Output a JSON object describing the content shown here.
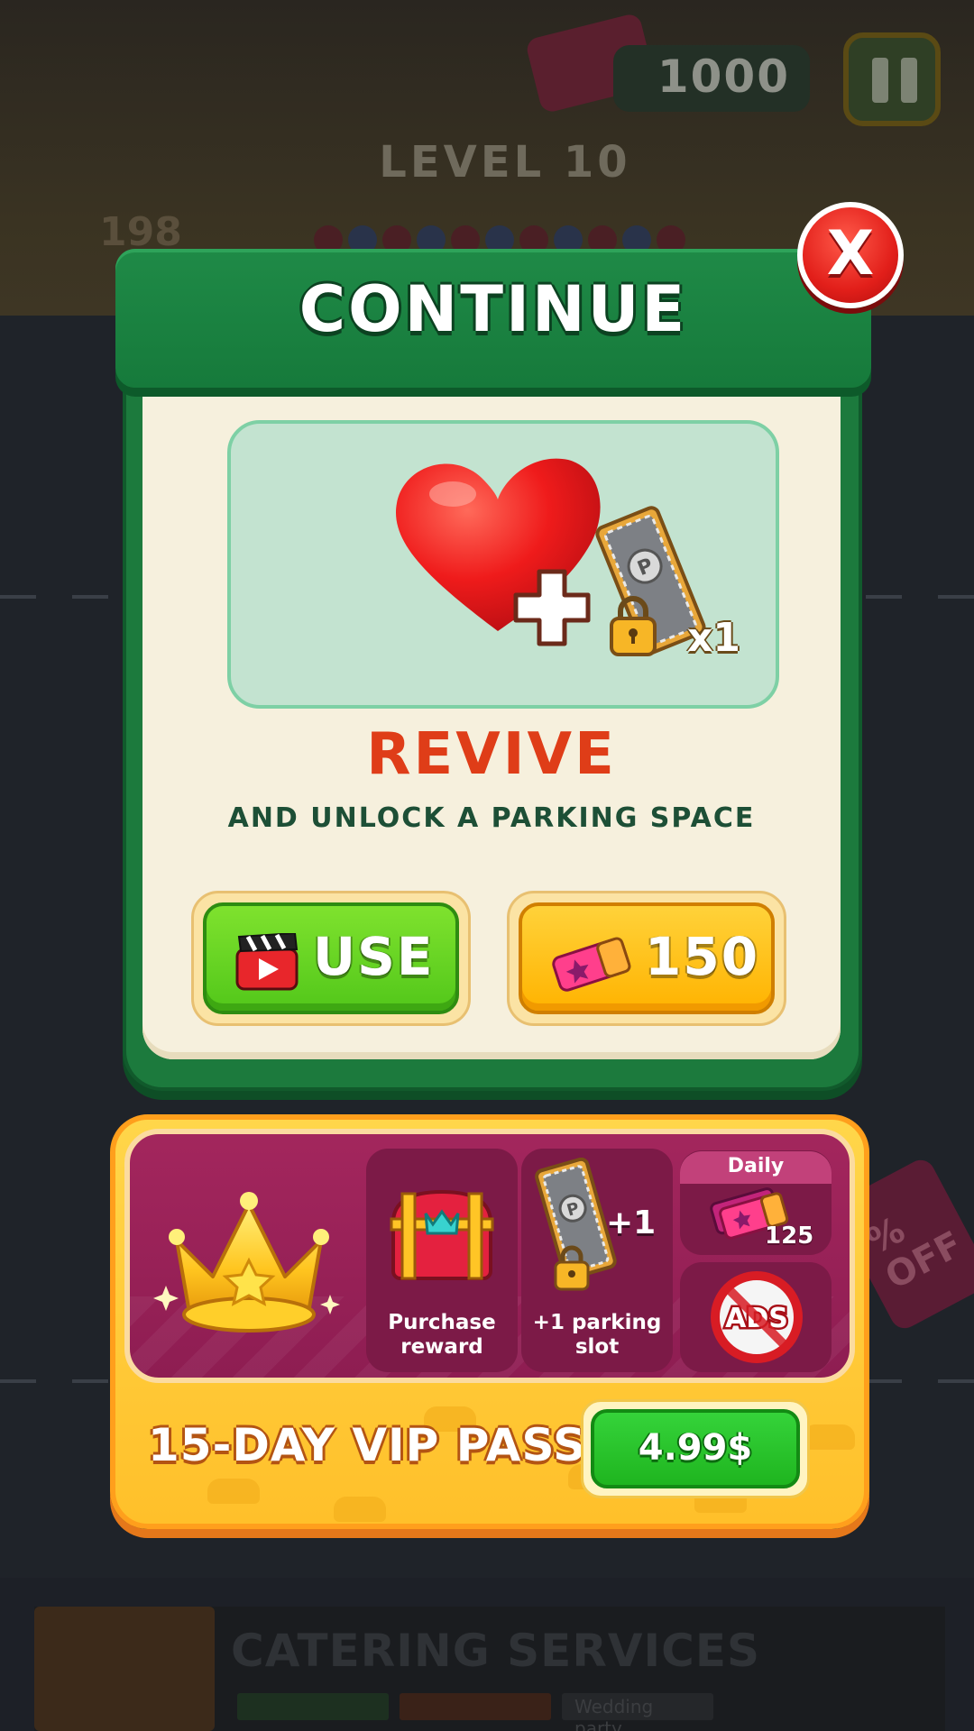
{
  "hud": {
    "coins": "1000",
    "level": "LEVEL 10",
    "remaining": "198",
    "icons": [
      "ticket-icon",
      "pause-icon"
    ]
  },
  "side_offer": {
    "text": "% OFF"
  },
  "modal": {
    "title": "CONTINUE",
    "close_label": "X",
    "reward_quantity": "x1",
    "revive_title": "REVIVE",
    "revive_subtitle": "AND UNLOCK A PARKING SPACE",
    "use_label": "USE",
    "buy_price": "150",
    "icons": [
      "heart-icon",
      "plus-icon",
      "parking-ticket-icon",
      "lock-icon",
      "video-ad-icon",
      "ticket-icon"
    ]
  },
  "vip": {
    "title": "15-DAY VIP PASS",
    "price": "4.99$",
    "perks": {
      "purchase_reward": "Purchase reward",
      "parking_slot": "+1 parking slot",
      "parking_badge": "+1",
      "daily_label": "Daily",
      "daily_value": "125",
      "ads_label": "ADS"
    },
    "icons": [
      "crown-icon",
      "treasure-chest-icon",
      "parking-ticket-icon",
      "tickets-icon",
      "no-ads-icon"
    ]
  },
  "ad_banner": {
    "title": "CATERING SERVICES",
    "chip_3": "Wedding party"
  },
  "colors": {
    "header_green": "#1f8a47",
    "revive_red": "#df3d18",
    "use_green": "#52c71a",
    "buy_orange": "#ffb300",
    "vip_magenta": "#8e1d52",
    "vip_gold": "#ffc02a",
    "price_green": "#1fb51f"
  }
}
